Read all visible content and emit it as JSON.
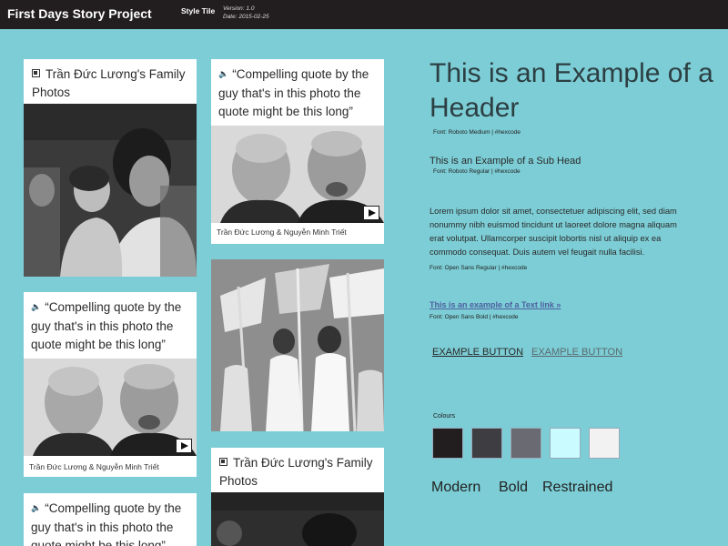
{
  "header": {
    "title": "First Days Story Project",
    "tile_label": "Style Tile",
    "version": "Version: 1.0",
    "date": "Date: 2015-02-25"
  },
  "cards": {
    "family1_title": "Trần Đức Lương's Family Photos",
    "quote1": "“Compelling quote by the guy that's in this photo the quote might be this long”",
    "caption1": "Trần Đức Lương & Nguyễn Minh Triết",
    "quote2": "“Compelling quote by the guy that's in this photo the quote might be this long”",
    "caption2": "Trần Đức Lương & Nguyễn Minh Triết",
    "family2_title": "Trần Đức Lương's Family Photos",
    "quote3": "“Compelling quote by the guy that's in this photo the quote might be this long”"
  },
  "style": {
    "header_example": "This is an Example of a Header",
    "header_font": "Font: Roboto Medium | #hexcode",
    "subhead_example": "This is an Example of a Sub Head",
    "subhead_font": "Font: Roboto Regular | #hexcode",
    "body_text": "Lorem ipsum dolor sit amet, consectetuer adipiscing elit, sed diam nonummy nibh euismod tincidunt ut laoreet dolore magna aliquam erat volutpat. Ullamcorper suscipit lobortis nisl ut aliquip ex ea commodo consequat. Duis autem vel feugait nulla facilisi.",
    "body_font": "Font: Open Sans Regular | #hexcode",
    "text_link": "This is an example of a Text link »",
    "text_link_font": "Font: Open Sans Bold | #hexcode",
    "button1": "EXAMPLE BUTTON",
    "button2": "EXAMPLE BUTTON",
    "colours_label": "Colours",
    "colours": [
      "#221e1f",
      "#3d3d42",
      "#6a6a72",
      "#c9fbff",
      "#f2f2f2"
    ],
    "words": [
      "Modern",
      "Bold",
      "Restrained"
    ]
  }
}
